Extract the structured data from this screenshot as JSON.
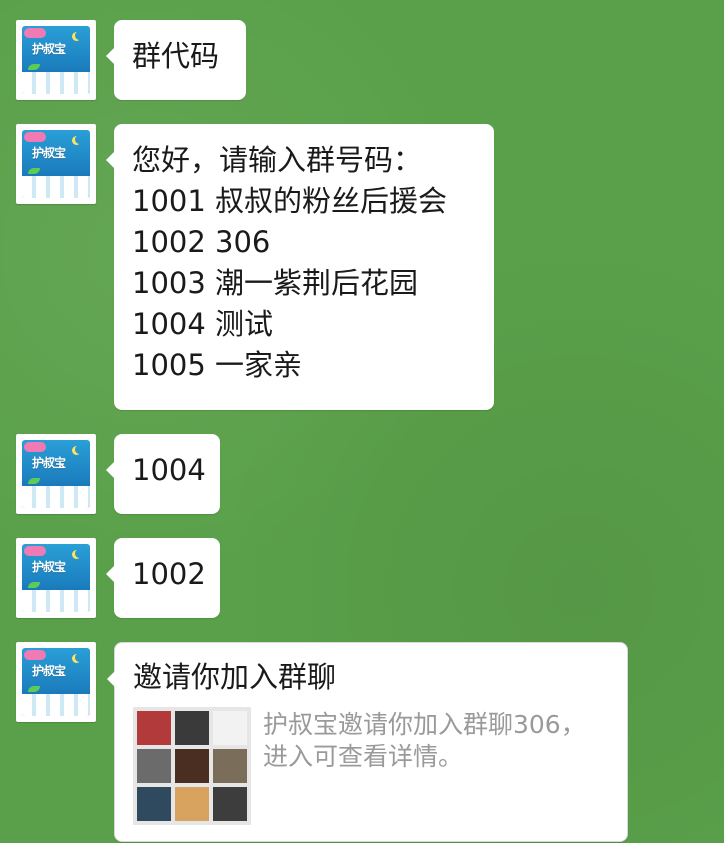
{
  "sender": {
    "avatar_icon": "sanitary-pad-pack-icon",
    "avatar_brand_text": "护叔宝"
  },
  "messages": [
    {
      "type": "text",
      "lines": [
        "群代码"
      ]
    },
    {
      "type": "text",
      "lines": [
        "您好，请输入群号码：",
        "1001 叔叔的粉丝后援会",
        "1002 306",
        "1003 潮一紫荆后花园",
        "1004 测试",
        "1005 一家亲"
      ]
    },
    {
      "type": "text",
      "lines": [
        "1004"
      ]
    },
    {
      "type": "text",
      "lines": [
        "1002"
      ]
    },
    {
      "type": "invite_card",
      "title": "邀请你加入群聊",
      "description": "护叔宝邀请你加入群聊306，进入可查看详情。",
      "thumbnail_colors": [
        "#b33a3a",
        "#3a3a3a",
        "#f2f2f2",
        "#6b6b6b",
        "#4a2e22",
        "#7a6d5a",
        "#2f4a5e",
        "#d7a35e",
        "#3d3d3d"
      ]
    }
  ],
  "colors": {
    "background": "#5aa04a",
    "bubble": "#ffffff",
    "text": "#1a1a1a",
    "secondary_text": "#9a9a9a"
  }
}
